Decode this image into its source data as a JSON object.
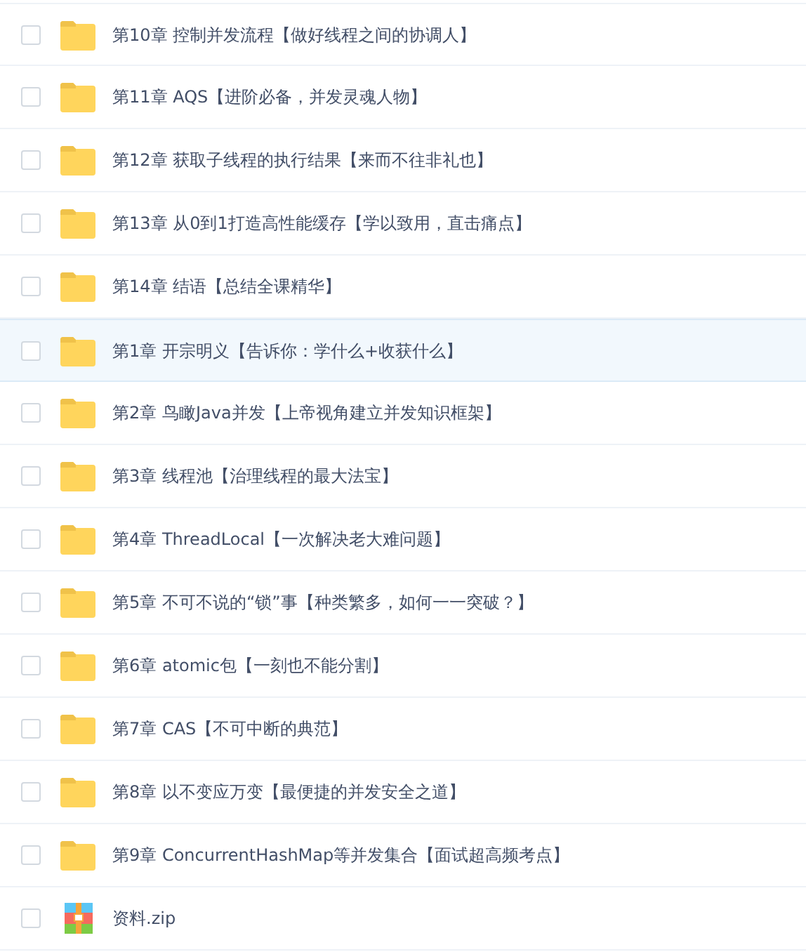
{
  "files": [
    {
      "kind": "folder",
      "name": "第10章 控制并发流程【做好线程之间的协调人】",
      "checked": false,
      "highlighted": false
    },
    {
      "kind": "folder",
      "name": "第11章 AQS【进阶必备，并发灵魂人物】",
      "checked": false,
      "highlighted": false
    },
    {
      "kind": "folder",
      "name": "第12章 获取子线程的执行结果【来而不往非礼也】",
      "checked": false,
      "highlighted": false
    },
    {
      "kind": "folder",
      "name": "第13章 从0到1打造高性能缓存【学以致用，直击痛点】",
      "checked": false,
      "highlighted": false
    },
    {
      "kind": "folder",
      "name": "第14章 结语【总结全课精华】",
      "checked": false,
      "highlighted": false
    },
    {
      "kind": "folder",
      "name": "第1章 开宗明义【告诉你：学什么+收获什么】",
      "checked": false,
      "highlighted": true
    },
    {
      "kind": "folder",
      "name": "第2章 鸟瞰Java并发【上帝视角建立并发知识框架】",
      "checked": false,
      "highlighted": false
    },
    {
      "kind": "folder",
      "name": "第3章 线程池【治理线程的最大法宝】",
      "checked": false,
      "highlighted": false
    },
    {
      "kind": "folder",
      "name": "第4章 ThreadLocal【一次解决老大难问题】",
      "checked": false,
      "highlighted": false
    },
    {
      "kind": "folder",
      "name": "第5章 不可不说的“锁”事【种类繁多，如何一一突破？】",
      "checked": false,
      "highlighted": false
    },
    {
      "kind": "folder",
      "name": "第6章 atomic包【一刻也不能分割】",
      "checked": false,
      "highlighted": false
    },
    {
      "kind": "folder",
      "name": "第7章 CAS【不可中断的典范】",
      "checked": false,
      "highlighted": false
    },
    {
      "kind": "folder",
      "name": "第8章 以不变应万变【最便捷的并发安全之道】",
      "checked": false,
      "highlighted": false
    },
    {
      "kind": "folder",
      "name": "第9章 ConcurrentHashMap等并发集合【面试超高频考点】",
      "checked": false,
      "highlighted": false
    },
    {
      "kind": "zip",
      "name": "资料.zip",
      "checked": false,
      "highlighted": false
    }
  ]
}
